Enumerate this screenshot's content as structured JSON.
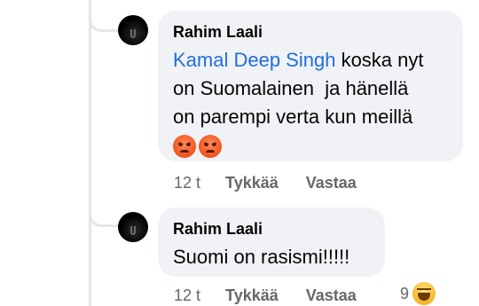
{
  "comments": [
    {
      "author": "Rahim Laali",
      "mention": "Kamal Deep Singh",
      "text": " koska nyt\non Suomalainen  ja hänellä\non parempi verta kun meillä",
      "emojis": [
        "angry-face-emoji",
        "angry-face-emoji"
      ],
      "time": "12 t",
      "like_label": "Tykkää",
      "reply_label": "Vastaa"
    },
    {
      "author": "Rahim Laali",
      "text": "Suomi on rasismi!!!!!",
      "time": "12 t",
      "like_label": "Tykkää",
      "reply_label": "Vastaa",
      "reaction_count": "9",
      "reaction_icon": "haha-reaction-icon"
    }
  ],
  "colors": {
    "bubble": "#f0f2f5",
    "mention": "#216fdb",
    "meta": "#65676b",
    "thread_line": "#e4e6eb"
  }
}
